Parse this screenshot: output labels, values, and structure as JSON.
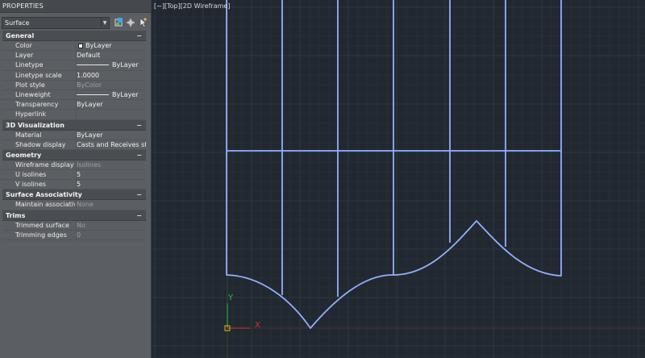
{
  "palette": {
    "title": "PROPERTIES",
    "selection": "Surface",
    "toolbar_icons": [
      "quick-select-icon",
      "select-objects-icon",
      "toggle-pickadd-icon"
    ],
    "sections": [
      {
        "label": "General",
        "toggle": "−",
        "rows": [
          {
            "key": "Color",
            "value": "ByLayer",
            "swatch": "#ffffff"
          },
          {
            "key": "Layer",
            "value": "Default"
          },
          {
            "key": "Linetype",
            "value": "ByLayer",
            "line": true
          },
          {
            "key": "Linetype scale",
            "value": "1.0000"
          },
          {
            "key": "Plot style",
            "value": "ByColor",
            "dim": true
          },
          {
            "key": "Lineweight",
            "value": "ByLayer",
            "line": true
          },
          {
            "key": "Transparency",
            "value": "ByLayer"
          },
          {
            "key": "Hyperlink",
            "value": ""
          }
        ]
      },
      {
        "label": "3D Visualization",
        "toggle": "−",
        "rows": [
          {
            "key": "Material",
            "value": "ByLayer"
          },
          {
            "key": "Shadow display",
            "value": "Casts and Receives sha..."
          }
        ]
      },
      {
        "label": "Geometry",
        "toggle": "−",
        "rows": [
          {
            "key": "Wireframe display",
            "value": "Isolines",
            "dim": true
          },
          {
            "key": "U isolines",
            "value": "5"
          },
          {
            "key": "V isolines",
            "value": "5"
          }
        ]
      },
      {
        "label": "Surface Associativity",
        "toggle": "−",
        "rows": [
          {
            "key": "Maintain associativ...",
            "value": "None",
            "dim": true
          }
        ]
      },
      {
        "label": "Trims",
        "toggle": "−",
        "rows": [
          {
            "key": "Trimmed surface",
            "value": "No",
            "dim": true
          },
          {
            "key": "Trimming edges",
            "value": "0",
            "dim": true
          }
        ]
      }
    ]
  },
  "viewport": {
    "label": "[−][Top][2D Wireframe]",
    "ucs": {
      "x_label": "X",
      "y_label": "Y"
    },
    "colors": {
      "background": "#212830",
      "grid_minor": "#262e37",
      "grid_major": "#2d3743",
      "wire": "#8fb0ff",
      "axis_x": "#e0302c",
      "axis_y": "#2cbf37"
    }
  }
}
